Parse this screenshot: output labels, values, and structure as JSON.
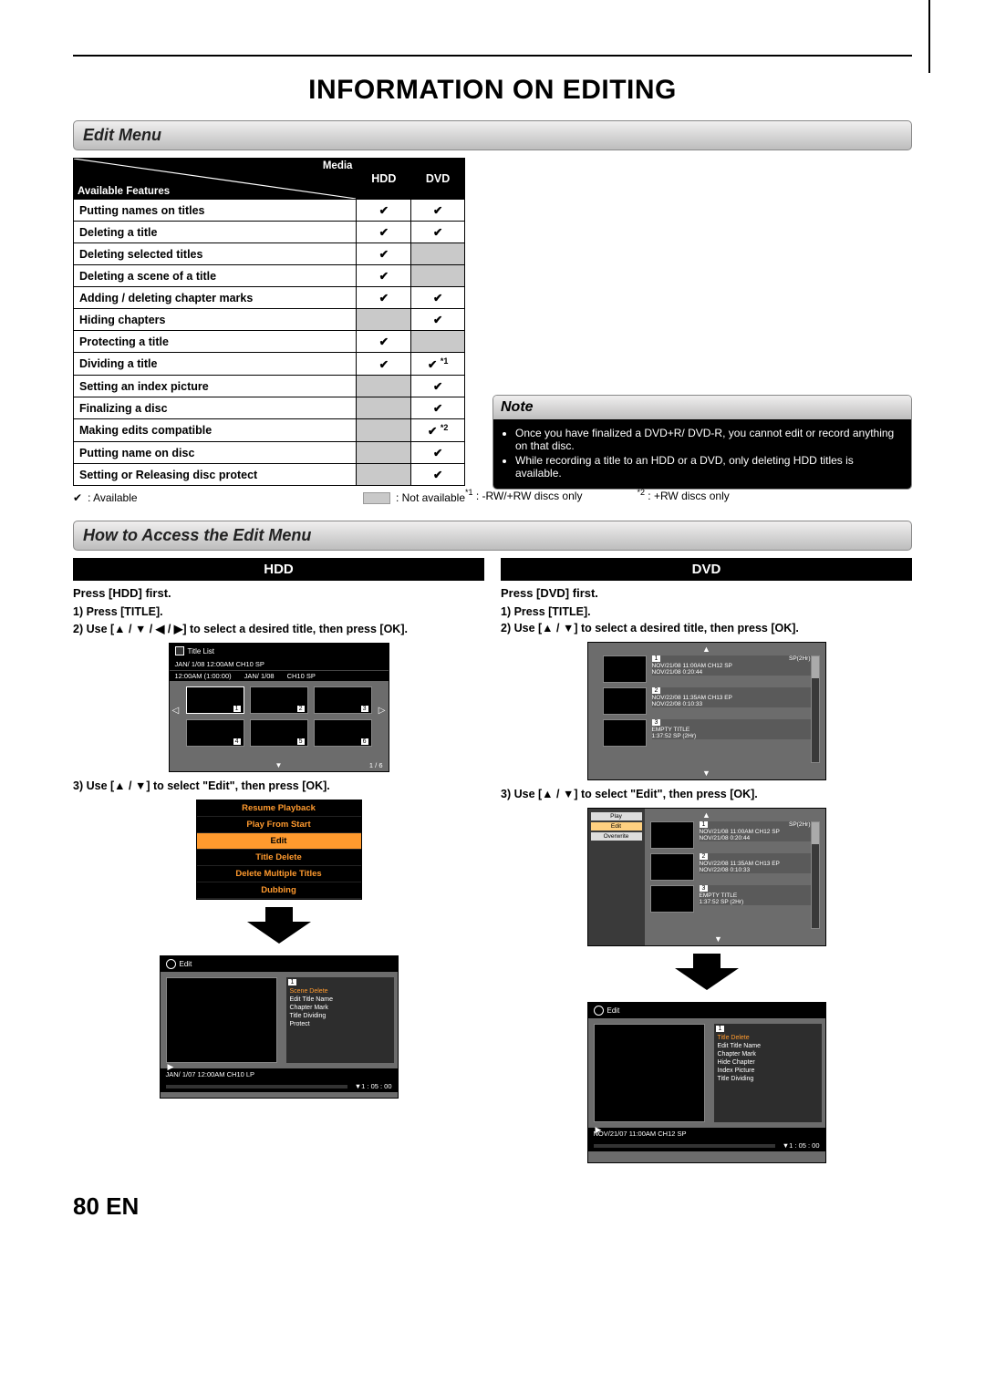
{
  "page_title": "INFORMATION ON EDITING",
  "sections": {
    "edit_menu": "Edit Menu",
    "how_to": "How to Access the Edit Menu"
  },
  "feature_table": {
    "header_media": "Media",
    "header_available": "Available Features",
    "col_hdd": "HDD",
    "col_dvd": "DVD",
    "rows": [
      {
        "label": "Putting names on titles",
        "hdd": "check",
        "dvd": "check"
      },
      {
        "label": "Deleting a title",
        "hdd": "check",
        "dvd": "check"
      },
      {
        "label": "Deleting selected titles",
        "hdd": "check",
        "dvd": "grey"
      },
      {
        "label": "Deleting a scene of a title",
        "hdd": "check",
        "dvd": "grey"
      },
      {
        "label": "Adding / deleting chapter marks",
        "hdd": "check",
        "dvd": "check"
      },
      {
        "label": "Hiding chapters",
        "hdd": "grey",
        "dvd": "check"
      },
      {
        "label": "Protecting a title",
        "hdd": "check",
        "dvd": "grey"
      },
      {
        "label": "Dividing a title",
        "hdd": "check",
        "dvd": "check_f1"
      },
      {
        "label": "Setting an index picture",
        "hdd": "grey",
        "dvd": "check"
      },
      {
        "label": "Finalizing a disc",
        "hdd": "grey",
        "dvd": "check"
      },
      {
        "label": "Making edits compatible",
        "hdd": "grey",
        "dvd": "check_f2"
      },
      {
        "label": "Putting name on disc",
        "hdd": "grey",
        "dvd": "check"
      },
      {
        "label": "Setting or Releasing disc protect",
        "hdd": "grey",
        "dvd": "check"
      }
    ]
  },
  "legend": {
    "check_label": ": Available",
    "grey_label": ": Not available",
    "f1": ": -RW/+RW discs only",
    "f2": ": +RW discs only",
    "f1_mark": "*1",
    "f2_mark": "*2"
  },
  "note": {
    "heading": "Note",
    "items": [
      "Once you have finalized a DVD+R/ DVD-R, you cannot edit or record anything on that disc.",
      "While recording a title to an HDD or a DVD, only deleting HDD titles is available."
    ]
  },
  "access": {
    "hdd_heading": "HDD",
    "dvd_heading": "DVD",
    "hdd_press_first": "Press [HDD] first.",
    "dvd_press_first": "Press [DVD] first.",
    "step1": "1) Press [TITLE].",
    "hdd_step2": "2) Use [▲ / ▼ / ◀ / ▶] to select a desired title, then press [OK].",
    "dvd_step2": "2) Use [▲ / ▼] to select a desired title, then press [OK].",
    "step3": "3) Use [▲ / ▼] to select \"Edit\", then press [OK]."
  },
  "title_list": {
    "title": "Title List",
    "line1": "JAN/ 1/08 12:00AM  CH10  SP",
    "line2_a": "12:00AM (1:00:00)",
    "line2_b": "JAN/ 1/08",
    "line2_c": "CH10  SP",
    "page": "1 / 6"
  },
  "hdd_menu": {
    "items": [
      "Resume Playback",
      "Play From Start",
      "Edit",
      "Title Delete",
      "Delete Multiple Titles",
      "Dubbing"
    ],
    "selected": "Edit"
  },
  "hdd_edit": {
    "header": "Edit",
    "num": "1",
    "opts": [
      "Scene Delete",
      "Edit Title Name",
      "Chapter Mark",
      "Title Dividing",
      "Protect"
    ],
    "footer_title": "JAN/ 1/07 12:00AM CH10  LP",
    "footer_time": "1 : 05 : 00"
  },
  "dvd_list": {
    "badge": "SP(2Hr)",
    "rows": [
      {
        "n": "1",
        "l1": "NOV/21/08  11:00AM CH12  SP",
        "l2": "NOV/21/08    0:20:44"
      },
      {
        "n": "2",
        "l1": "NOV/22/08  11:35AM CH13  EP",
        "l2": "NOV/22/08    0:10:33"
      },
      {
        "n": "3",
        "l1": "EMPTY TITLE",
        "l2": "1:37:52  SP (2Hr)"
      }
    ]
  },
  "dvd_pe_menu": {
    "items": [
      "Play",
      "Edit",
      "Overwrite"
    ],
    "selected": "Edit"
  },
  "dvd_edit": {
    "header": "Edit",
    "num": "1",
    "opts": [
      "Title Delete",
      "Edit Title Name",
      "Chapter Mark",
      "Hide Chapter",
      "Index Picture",
      "Title Dividing"
    ],
    "footer_title": "NOV/21/07 11:00AM CH12 SP",
    "footer_time": "1 : 05 : 00"
  },
  "footer": {
    "page": "80",
    "lang": "EN"
  }
}
